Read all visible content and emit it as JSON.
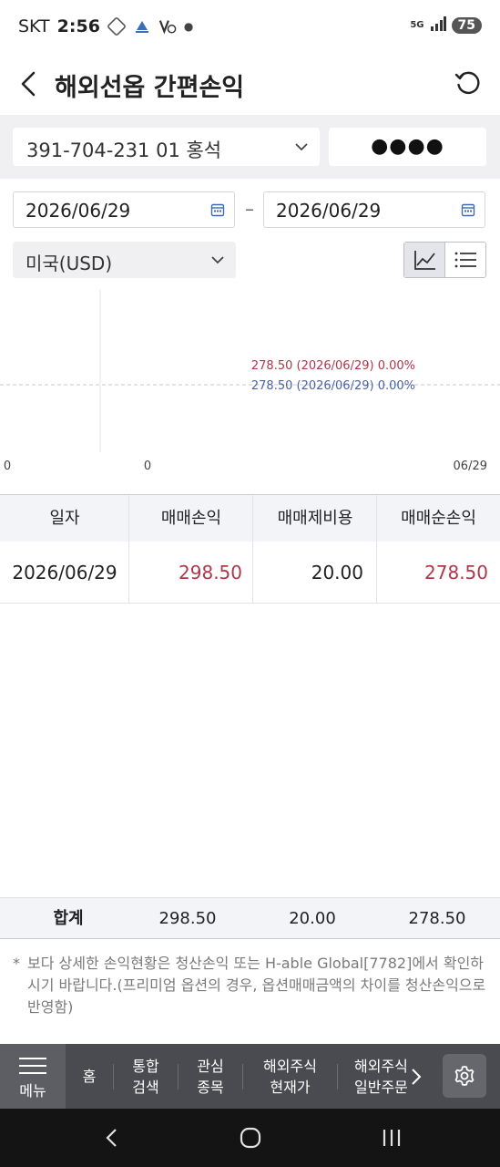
{
  "status_bar": {
    "carrier": "SKT",
    "time": "2:56",
    "network": "5G",
    "battery": "75"
  },
  "header": {
    "title": "해외선옵 간편손익"
  },
  "account": {
    "value": "391-704-231 01 홍석",
    "password_mask": "●●●●"
  },
  "dates": {
    "start": "2026/06/29",
    "separator": "–",
    "end": "2026/06/29"
  },
  "currency": {
    "selected": "미국(USD)"
  },
  "chart_data": {
    "type": "line",
    "x_tick_labels": [
      "0",
      "0",
      "06/29"
    ],
    "series": [
      {
        "label": "278.50 (2026/06/29) 0.00%",
        "color": "#b0364a",
        "x": "2026/06/29",
        "y": 278.5
      },
      {
        "label": "278.50 (2026/06/29) 0.00%",
        "color": "#4a63a8",
        "x": "2026/06/29",
        "y": 278.5
      }
    ],
    "grid": true
  },
  "table": {
    "headers": [
      "일자",
      "매매손익",
      "매매제비용",
      "매매순손익"
    ],
    "rows": [
      {
        "date": "2026/06/29",
        "trade_pl": "298.50",
        "fees": "20.00",
        "net_pl": "278.50"
      }
    ]
  },
  "totals": {
    "label": "합계",
    "trade_pl": "298.50",
    "fees": "20.00",
    "net_pl": "278.50"
  },
  "notice": {
    "star": "*",
    "text": "보다 상세한 손익현황은 청산손익 또는 H-able Global[7782]에서 확인하시기 바랍니다.(프리미엄 옵션의 경우, 옵션매매금액의 차이를 청산손익으로 반영함)"
  },
  "bottom_nav": {
    "menu": "메뉴",
    "items": [
      {
        "label": "홈"
      },
      {
        "label": "통합\n검색"
      },
      {
        "label": "관심\n종목"
      },
      {
        "label": "해외주식\n현재가"
      },
      {
        "label": "해외주식\n일반주문"
      }
    ]
  },
  "colors": {
    "profit_red": "#b0364a",
    "series_blue": "#4a63a8",
    "nav_bg": "#4a4b50"
  }
}
